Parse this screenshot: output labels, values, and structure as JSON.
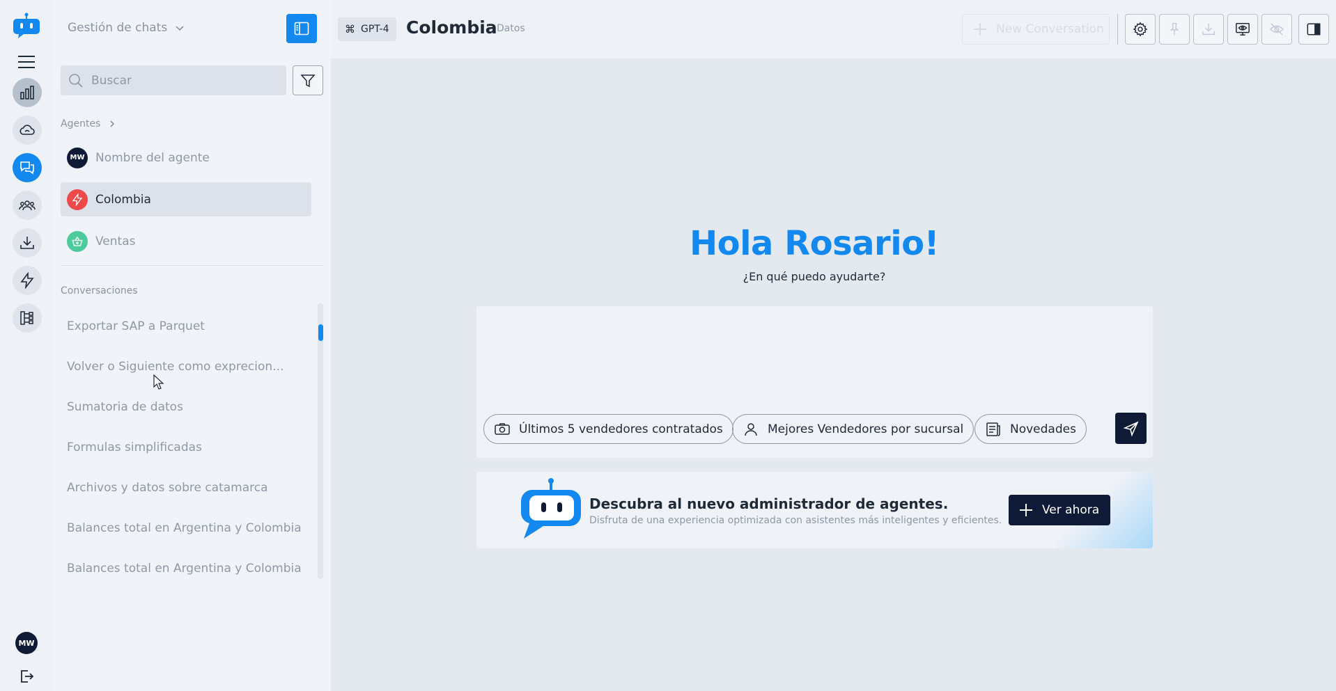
{
  "rail": {
    "avatar_initials": "MW"
  },
  "sidebar": {
    "title": "Gestión de chats",
    "search_placeholder": "Buscar",
    "agents_label": "Agentes",
    "agents": [
      {
        "initials": "MW",
        "name": "Nombre del agente",
        "color": "#0e1a36"
      },
      {
        "initials": "",
        "name": "Colombia",
        "color": "#ee4a4a",
        "icon": "bolt-icon"
      },
      {
        "initials": "",
        "name": "Ventas",
        "color": "#4ecb9d",
        "icon": "basket-icon"
      }
    ],
    "conversations_label": "Conversaciones",
    "conversations": [
      "Exportar SAP a Parquet",
      "Volver o Siguiente como exprecion...",
      "Sumatoria de datos",
      "Formulas simplificadas",
      "Archivos y datos sobre catamarca",
      "Balances total en Argentina y Colombia",
      "Balances total en Argentina y Colombia"
    ]
  },
  "header": {
    "model": "GPT-4",
    "title": "Colombia",
    "subtitle": "Datos",
    "new_conversation": "New Conversation"
  },
  "main": {
    "greeting": "Hola Rosario!",
    "subgreeting": "¿En qué puedo ayudarte?",
    "input_value": "",
    "chips": [
      {
        "label": "Últimos 5  vendedores contratados",
        "icon": "camera-icon"
      },
      {
        "label": "Mejores  Vendedores por sucursal",
        "icon": "user-icon"
      },
      {
        "label": "Novedades",
        "icon": "news-icon"
      }
    ]
  },
  "banner": {
    "title": "Descubra al nuevo administrador de agentes.",
    "text": "Disfruta de una experiencia optimizada con asistentes más inteligentes y eficientes.",
    "cta": "Ver ahora"
  },
  "colors": {
    "accent": "#1389f0",
    "dark": "#0e1a36",
    "muted": "#8f98a6"
  }
}
